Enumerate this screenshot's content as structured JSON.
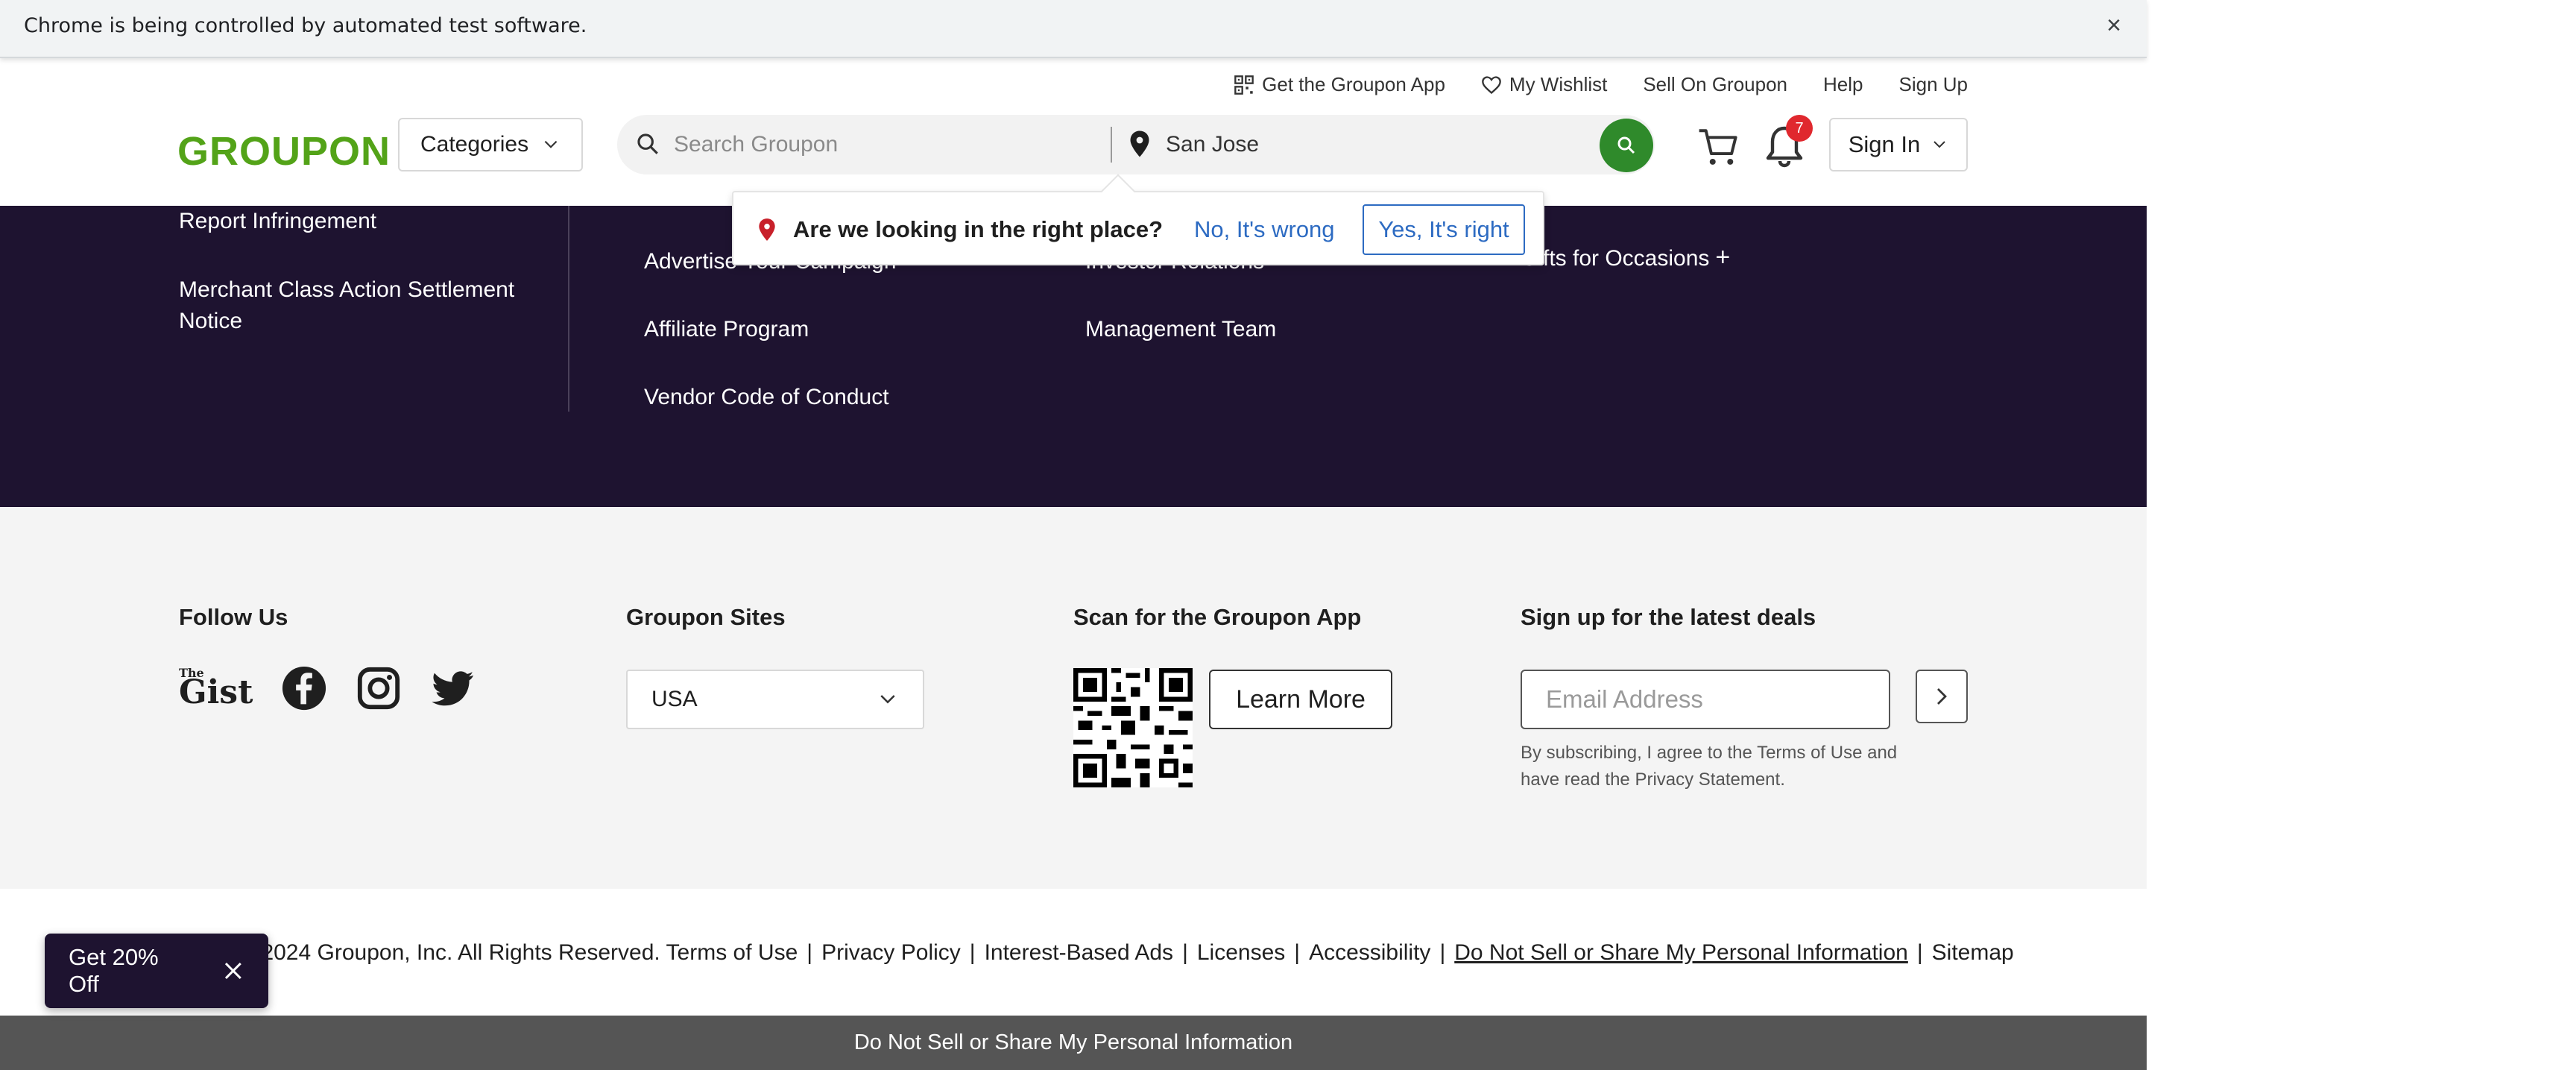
{
  "automation_banner": {
    "text": "Chrome is being controlled by automated test software.",
    "close": "×"
  },
  "header": {
    "utility_nav": [
      {
        "label": "Get the Groupon App",
        "icon": "qr-code-icon"
      },
      {
        "label": "My Wishlist",
        "icon": "heart-icon"
      },
      {
        "label": "Sell On Groupon"
      },
      {
        "label": "Help"
      },
      {
        "label": "Sign Up"
      }
    ],
    "logo": "GROUPON",
    "categories_label": "Categories",
    "search_placeholder": "Search Groupon",
    "location_value": "San Jose",
    "notification_count": "7",
    "signin_label": "Sign In"
  },
  "location_popup": {
    "question": "Are we looking in the right place?",
    "no_label": "No, It's wrong",
    "yes_label": "Yes, It's right"
  },
  "dark_footer": {
    "col1": [
      "Report Infringement",
      "Merchant Class Action Settlement Notice"
    ],
    "col2": [
      "Advertise Your Campaign",
      "Affiliate Program",
      "Vendor Code of Conduct"
    ],
    "col3": [
      "Investor Relations",
      "Management Team"
    ],
    "col4": [
      "Gifts for Occasions"
    ],
    "expand_symbol": "+"
  },
  "light_footer": {
    "follow_us": "Follow Us",
    "gist_the": "The",
    "gist_word": "Gist",
    "groupon_sites": "Groupon Sites",
    "country_selected": "USA",
    "scan_app": "Scan for the Groupon App",
    "learn_more": "Learn More",
    "signup_heading": "Sign up for the latest deals",
    "email_placeholder": "Email Address",
    "subscribe_note": "By subscribing, I agree to the Terms of Use and have read the Privacy Statement."
  },
  "legal": {
    "copyright": "© 2024 Groupon, Inc. All Rights Reserved.",
    "links": [
      "Terms of Use",
      "Privacy Policy",
      "Interest-Based Ads",
      "Licenses",
      "Accessibility",
      "Do Not Sell or Share My Personal Information",
      "Sitemap"
    ],
    "separator": "|"
  },
  "promo": {
    "label": "Get 20% Off"
  },
  "privacy_bar": {
    "label": "Do Not Sell or Share My Personal Information"
  },
  "colors": {
    "brand_green": "#53a318",
    "search_button": "#2f8a2b",
    "dark_footer": "#1e1330",
    "link_blue": "#2d6bc2",
    "badge_red": "#e0282e"
  }
}
